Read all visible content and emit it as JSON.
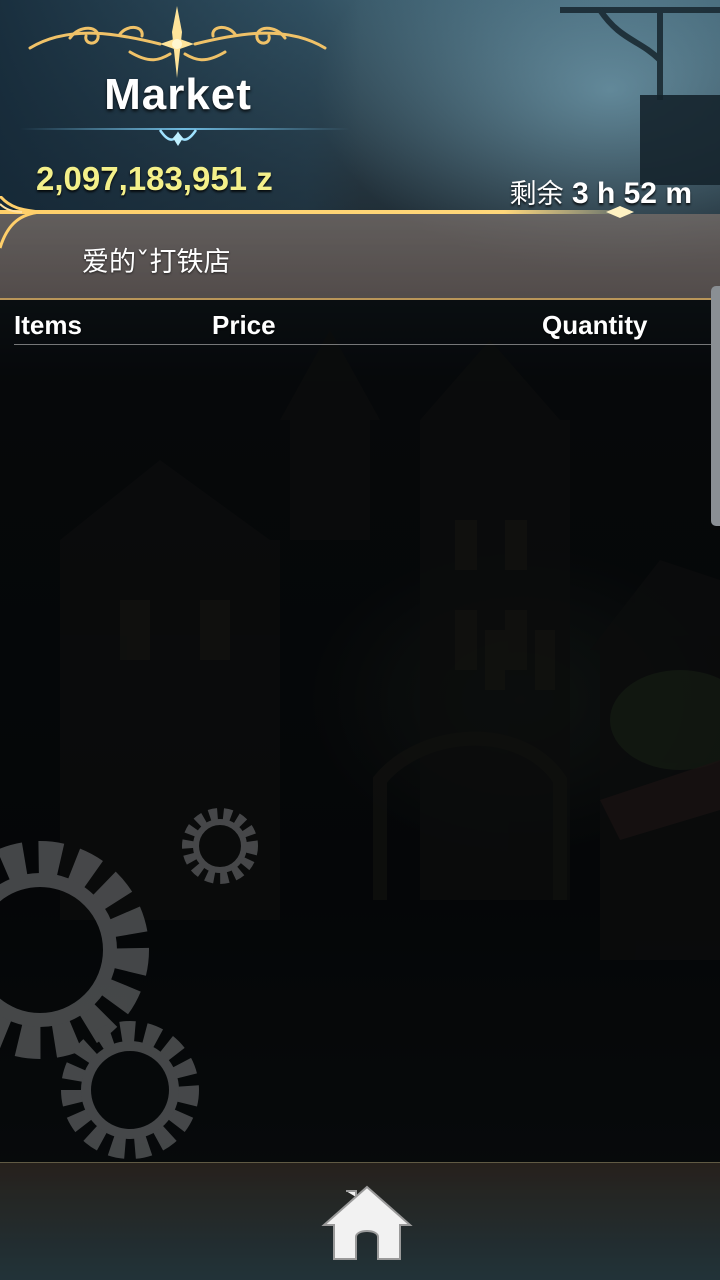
{
  "header": {
    "title": "Market",
    "money": "2,097,183,951 z",
    "timer_prefix": "剩余",
    "timer_value": "3 h 52 m"
  },
  "shop": {
    "name": "爱的ˇ打铁店"
  },
  "table": {
    "columns": [
      "Items",
      "Price",
      "Quantity"
    ],
    "rows": []
  },
  "footer": {
    "home_icon": "home-icon"
  },
  "colors": {
    "money": "#f4f08a",
    "gold_accent": "#e7b24a",
    "text": "#ffffff"
  }
}
